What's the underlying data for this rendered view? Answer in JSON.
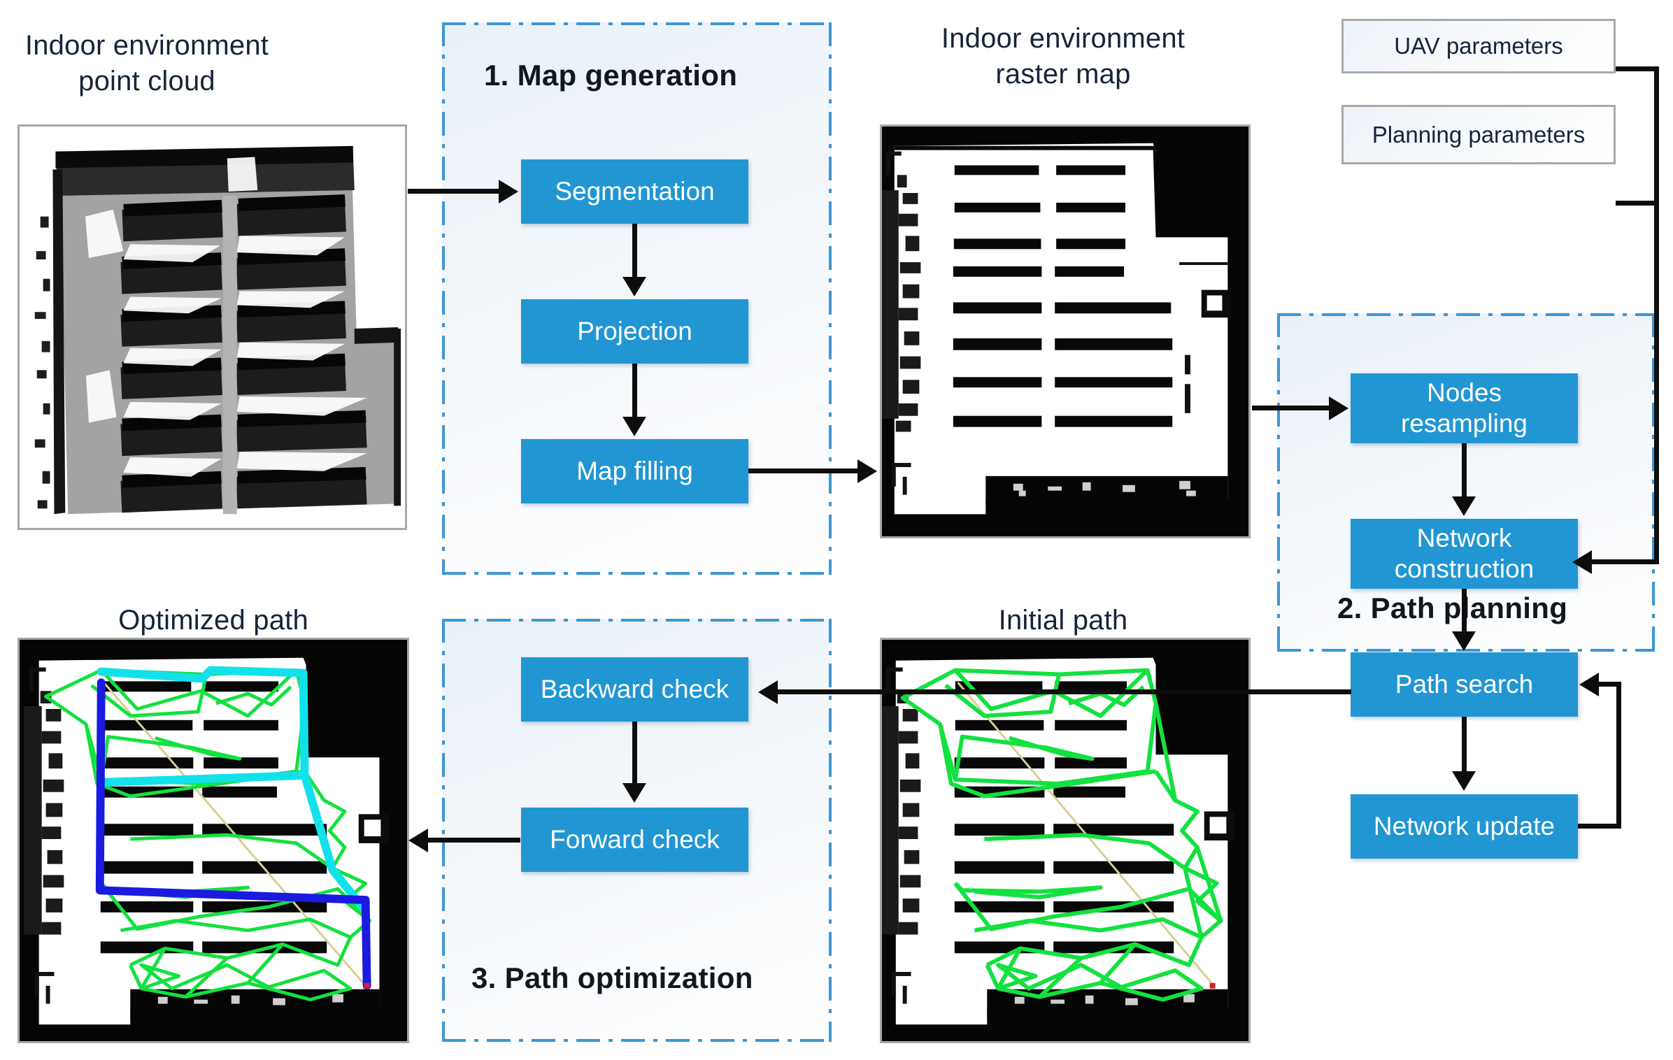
{
  "diagram": {
    "title_hidden": "",
    "accent_blue": "#2196d3",
    "dash_blue": "#3d96d4",
    "panel_border": "#a7a7a7",
    "connector_black": "#0d0d0d",
    "path_green": "#13e13f",
    "path_cyan": "#13e1ea",
    "path_blue": "#1a1ae0"
  },
  "captions": {
    "point_cloud": "Indoor environment\npoint cloud",
    "raster_map": "Indoor  environment\nraster map",
    "initial_path": "Initial path",
    "optimized_path": "Optimized path"
  },
  "groups": {
    "map_generation": {
      "title": "1. Map generation",
      "steps": [
        {
          "label": "Segmentation"
        },
        {
          "label": "Projection"
        },
        {
          "label": "Map filling"
        }
      ]
    },
    "path_planning": {
      "title": "2. Path planning",
      "steps": [
        {
          "label": "Nodes\nresampling"
        },
        {
          "label": "Network\nconstruction"
        },
        {
          "label": "Path search"
        },
        {
          "label": "Network update"
        }
      ]
    },
    "path_optimization": {
      "title": "3. Path optimization",
      "steps": [
        {
          "label": "Backward check"
        },
        {
          "label": "Forward check"
        }
      ]
    }
  },
  "parameters": {
    "uav": "UAV parameters",
    "planning": "Planning parameters"
  }
}
